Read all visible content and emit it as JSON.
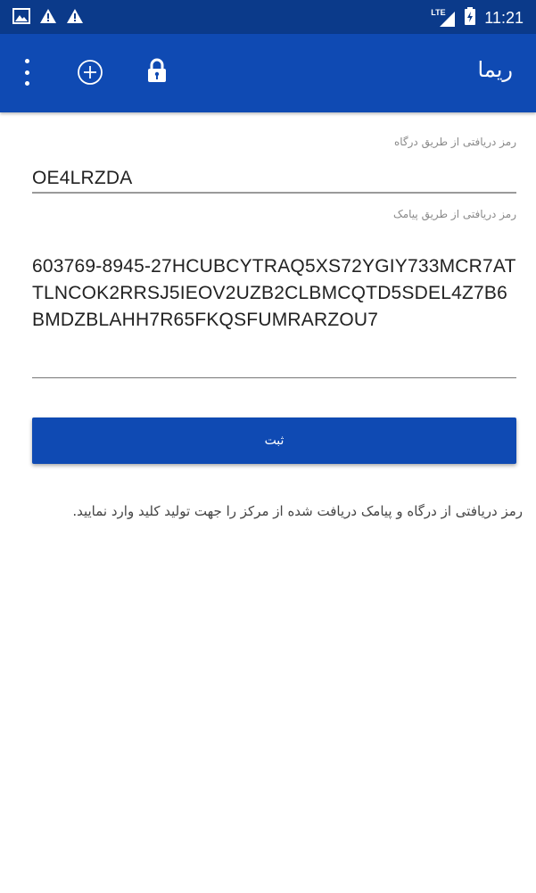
{
  "status_bar": {
    "time": "11:21",
    "network_label": "LTE",
    "icons": [
      "gallery-icon",
      "warning-icon",
      "warning-icon",
      "signal-icon",
      "battery-icon"
    ]
  },
  "app_bar": {
    "title": "ریما",
    "icons": [
      "more-vert-icon",
      "add-circle-icon",
      "lock-icon"
    ]
  },
  "form": {
    "gateway_label": "رمز دریافتی از طریق درگاه",
    "gateway_value": "OE4LRZDA",
    "sms_label": "رمز دریافتی از طریق پیامک",
    "sms_value": "603769-8945-27HCUBCYTRAQ5XS72YGIY733MCR7ATTLNCOK2RRSJ5IEOV2UZB2CLBMCQTD5SDEL4Z7B6BMDZBLAHH7R65FKQSFUMRARZOU7",
    "submit_label": "ثبت"
  },
  "help_text": "رمز دریافتی از درگاه و پیامک دریافت شده از مرکز را جهت تولید کلید وارد نمایید.",
  "colors": {
    "status_bar": "#0b3a8a",
    "app_bar": "#0f4ab3",
    "button": "#0f4ab3"
  }
}
